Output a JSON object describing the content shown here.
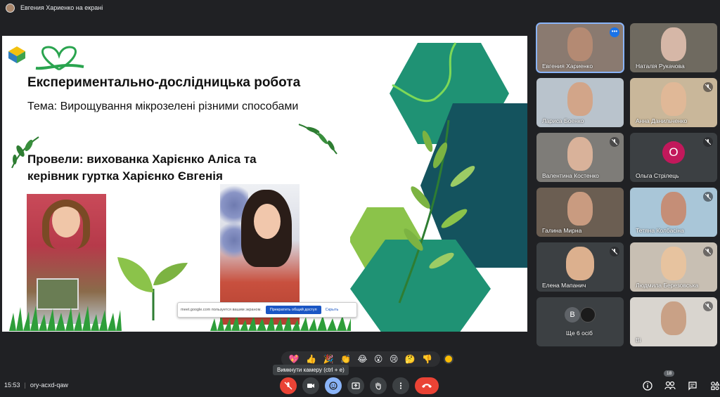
{
  "window": {
    "presenter_label": "Евгения Хариенко на екрані"
  },
  "slide": {
    "title": "Експериментально-дослідницька робота",
    "subtitle": "Тема: Вирощування мікрозелені різними способами",
    "authors_line1": "Провели: вихованка  Харієнко Аліса та",
    "authors_line2": "керівник гуртка Харієнко Євгенія"
  },
  "share_bar": {
    "message": "meet.google.com пользуется вашим экраном.",
    "stop_label": "Прекратить общий доступ",
    "hide_label": "Скрыть"
  },
  "participants": [
    {
      "name": "Евгения Хариенко",
      "selected": true
    },
    {
      "name": "Наталія Рукачова"
    },
    {
      "name": "Лариса Боенко"
    },
    {
      "name": "Анна Данильченко"
    },
    {
      "name": "Валентина Костенко"
    },
    {
      "name": "Ольга Стрілець",
      "initial": "О"
    },
    {
      "name": "Галина Мирна"
    },
    {
      "name": "Тетяна Колбасіна"
    },
    {
      "name": "Елена Мапанич"
    },
    {
      "name": "Людмила Березовська"
    },
    {
      "name": "Ще 6 осіб",
      "initial": "В"
    },
    {
      "name": "Ві"
    }
  ],
  "reactions": [
    "💖",
    "👍",
    "🎉",
    "👏",
    "😂",
    "😮",
    "😢",
    "🤔",
    "👎"
  ],
  "tooltip": "Вимкнути камеру (ctrl + e)",
  "meeting": {
    "time": "15:53",
    "code": "ory-acxd-qaw",
    "people_count": "18"
  },
  "colors": {
    "accent": "#8ab4f8",
    "danger": "#ea4335",
    "background": "#202124"
  }
}
